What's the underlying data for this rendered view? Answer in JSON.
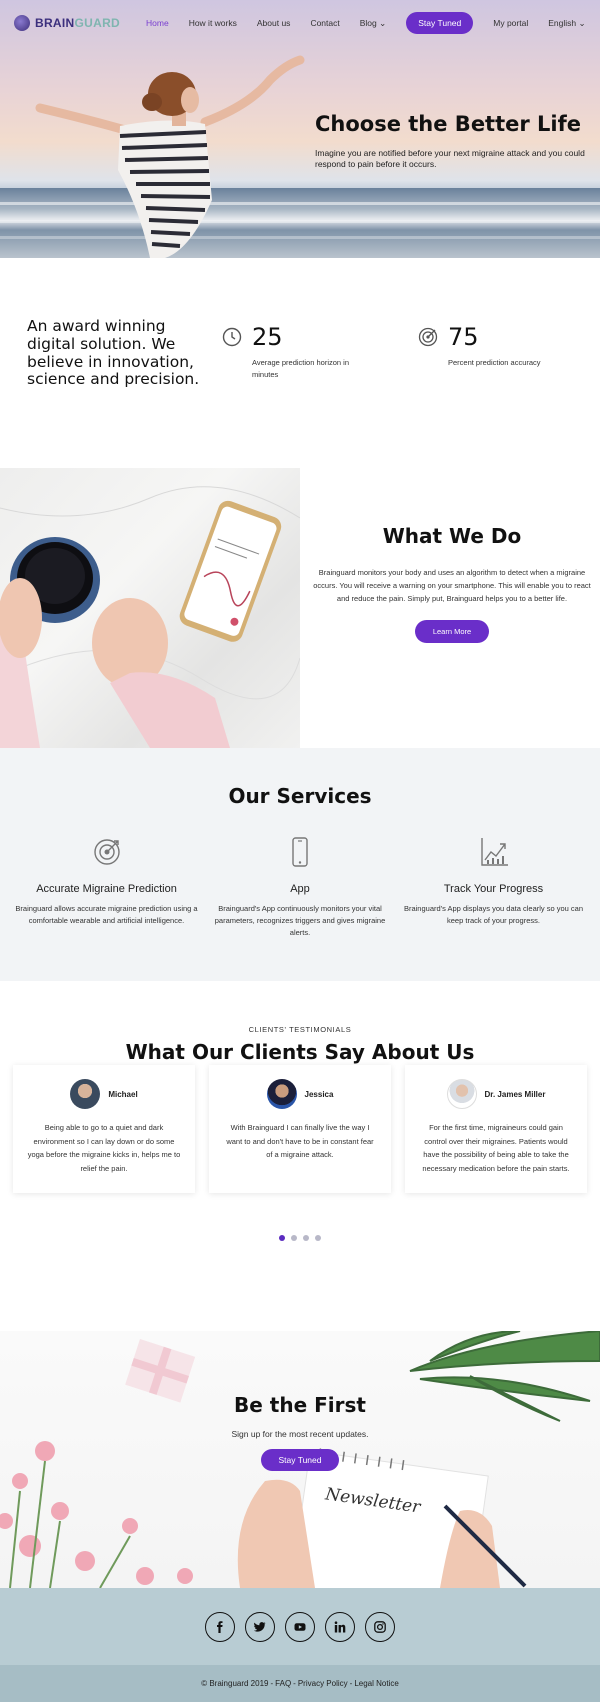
{
  "brand": {
    "name_a": "BRAIN",
    "name_b": "GUARD"
  },
  "nav": {
    "items": [
      "Home",
      "How it works",
      "About us",
      "Contact",
      "Blog"
    ],
    "cta": "Stay Tuned",
    "portal": "My portal",
    "language": "English"
  },
  "hero": {
    "title": "Choose the Better Life",
    "subtitle": "Imagine you are notified before your next migraine attack and you could respond to pain before it occurs."
  },
  "stats": {
    "tagline": "An award winning digital solution. We believe in innovation, science and precision.",
    "items": [
      {
        "icon": "clock-icon",
        "value": "25",
        "label": "Average prediction horizon in minutes"
      },
      {
        "icon": "target-icon",
        "value": "75",
        "label": "Percent prediction accuracy"
      }
    ]
  },
  "what_we_do": {
    "title": "What We Do",
    "text": "Brainguard monitors your body and uses an algorithm to detect when a migraine occurs. You will receive a warning on your smartphone. This will enable you to react and reduce the pain. Simply put, Brainguard helps you to a better life.",
    "button": "Learn More"
  },
  "services": {
    "title": "Our Services",
    "items": [
      {
        "icon": "target-icon",
        "title": "Accurate Migraine Prediction",
        "text": "Brainguard allows accurate migraine prediction using a comfortable wearable and artificial intelligence."
      },
      {
        "icon": "smartphone-icon",
        "title": "App",
        "text": "Brainguard's App continuously monitors your vital parameters, recognizes triggers and gives migraine alerts."
      },
      {
        "icon": "chart-icon",
        "title": "Track Your Progress",
        "text": "Brainguard's App displays you data clearly so you can keep track of your progress."
      }
    ]
  },
  "testimonials": {
    "eyebrow": "CLIENTS' TESTIMONIALS",
    "title": "What Our Clients Say About Us",
    "items": [
      {
        "name": "Michael",
        "quote": "Being able to go to a quiet and dark environment so I can lay down or do some yoga before the migraine kicks in, helps me to relief the pain."
      },
      {
        "name": "Jessica",
        "quote": "With Brainguard I can finally live the way I want to and don't have to be in constant fear of a migraine attack."
      },
      {
        "name": "Dr. James Miller",
        "quote": "For the first time, migraineurs could gain control over their migraines. Patients would have the possibility of being able to take the necessary medication before the pain starts."
      }
    ],
    "active_dot": 0,
    "dot_count": 4
  },
  "signup": {
    "title": "Be the First",
    "subtitle": "Sign up for the most recent updates.",
    "button": "Stay Tuned",
    "art_text": "Newsletter"
  },
  "social": [
    "facebook-icon",
    "twitter-icon",
    "youtube-icon",
    "linkedin-icon",
    "instagram-icon"
  ],
  "footer": {
    "copyright": "© Brainguard 2019",
    "sep": " - ",
    "faq": "FAQ",
    "privacy": "Privacy Policy",
    "legal": "Legal Notice"
  },
  "colors": {
    "accent": "#6a2ec9",
    "social_bg": "#b8ccd3",
    "footer_bg": "#a6bdc5",
    "services_bg": "#f2f4f6"
  }
}
